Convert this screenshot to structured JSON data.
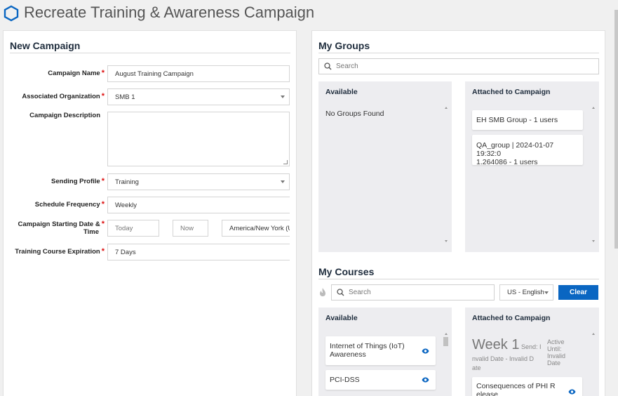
{
  "header": {
    "title": "Recreate Training & Awareness Campaign",
    "logo_icon": "hexagon-icon",
    "accent": "#0a66c2"
  },
  "new_campaign": {
    "title": "New Campaign",
    "fields": {
      "campaign_name": {
        "label": "Campaign Name",
        "value": "August Training Campaign",
        "required": "*"
      },
      "organization": {
        "label": "Associated Organization",
        "value": "SMB 1",
        "required": "*"
      },
      "description": {
        "label": "Campaign Description",
        "value": ""
      },
      "sending_profile": {
        "label": "Sending Profile",
        "value": "Training",
        "required": "*"
      },
      "frequency": {
        "label": "Schedule Frequency",
        "value": "Weekly",
        "required": "*"
      },
      "start": {
        "label": "Campaign Starting Date & Time",
        "label_line1": "Campaign Starting Date &",
        "label_line2": "Time",
        "date_placeholder": "Today",
        "time_placeholder": "Now",
        "timezone": "America/New York (U",
        "required": "*"
      },
      "expiration": {
        "label": "Training Course Expiration",
        "value": "7 Days",
        "required": "*"
      }
    }
  },
  "my_groups": {
    "title": "My Groups",
    "search_placeholder": "Search",
    "available": {
      "title": "Available",
      "empty": "No Groups Found"
    },
    "attached": {
      "title": "Attached to Campaign",
      "items": [
        {
          "label": "EH SMB Group - 1 users"
        },
        {
          "label_line1": "QA_group | 2024-01-07 19:32:0",
          "label_line2": "1.264086 - 1 users"
        }
      ]
    }
  },
  "my_courses": {
    "title": "My Courses",
    "search_placeholder": "Search",
    "language": "US - English",
    "clear_label": "Clear",
    "available": {
      "title": "Available",
      "items": [
        {
          "label_line1": "Internet of Things (IoT)",
          "label_line2": "Awareness"
        },
        {
          "label_line1": "PCI-DSS"
        }
      ]
    },
    "attached": {
      "title": "Attached to Campaign",
      "week_big": "Week 1",
      "week_send": " Send: I",
      "week_dates_line1": "nvalid Date - Invalid D",
      "week_dates_line2": "ate",
      "active_until": "Active Until: Invalid Date",
      "items": [
        {
          "label_line1": "Consequences of PHI R",
          "label_line2": "elease"
        }
      ]
    }
  }
}
